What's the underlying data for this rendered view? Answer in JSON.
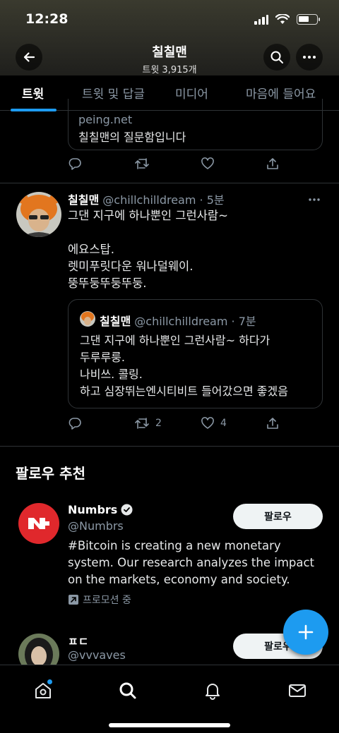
{
  "status_bar": {
    "time": "12:28"
  },
  "header": {
    "title": "칠칠맨",
    "subtitle": "트윗 3,915개"
  },
  "tabs": [
    {
      "label": "트윗",
      "active": true
    },
    {
      "label": "트윗 및 답글",
      "active": false
    },
    {
      "label": "미디어",
      "active": false
    },
    {
      "label": "마음에 들어요",
      "active": false
    }
  ],
  "prev_tweet": {
    "card": {
      "domain": "peing.net",
      "title": "칠칠맨의 질문함입니다"
    }
  },
  "tweet": {
    "name": "칠칠맨",
    "handle": "@chillchilldream",
    "time": "· 5분",
    "text": "그댄 지구에 하나뿐인 그런사람~\n\n에요스탑.\n렛미푸릿다운 워나덜웨이.\n뚱뚜둥뚜둥뚜둥.",
    "quote": {
      "name": "칠칠맨",
      "handle": "@chillchilldream",
      "time": "· 7분",
      "text": "그댄 지구에 하나뿐인 그런사람~ 하다가\n두루루룽.\n나비쓰. 콜링.\n하고 심장뛰는엔시티비트 들어갔으면 좋겠음"
    },
    "retweets": "2",
    "likes": "4"
  },
  "follow_section": {
    "title": "팔로우 추천",
    "accounts": [
      {
        "name": "Numbrs",
        "handle": "@Numbrs",
        "button": "팔로우",
        "bio": "#Bitcoin is creating a new monetary\nsystem. Our research analyzes the impact\non the markets, economy and society.",
        "promoted": "프로모션 중",
        "verified": true
      },
      {
        "name": "ㅍㄷ",
        "handle": "@vvvaves",
        "button": "팔로우"
      }
    ]
  },
  "colors": {
    "accent": "#1d9bf0",
    "background": "#000000",
    "secondary_text": "#8b98a5",
    "numbrs_brand": "#e0282c"
  },
  "icons": {
    "back": "arrow-left-icon",
    "search": "search-icon",
    "more": "more-icon",
    "reply": "reply-icon",
    "retweet": "retweet-icon",
    "like": "heart-icon",
    "share": "share-icon",
    "compose": "plus-icon",
    "home": "home-icon",
    "explore": "search-icon",
    "notifications": "bell-icon",
    "messages": "mail-icon"
  }
}
